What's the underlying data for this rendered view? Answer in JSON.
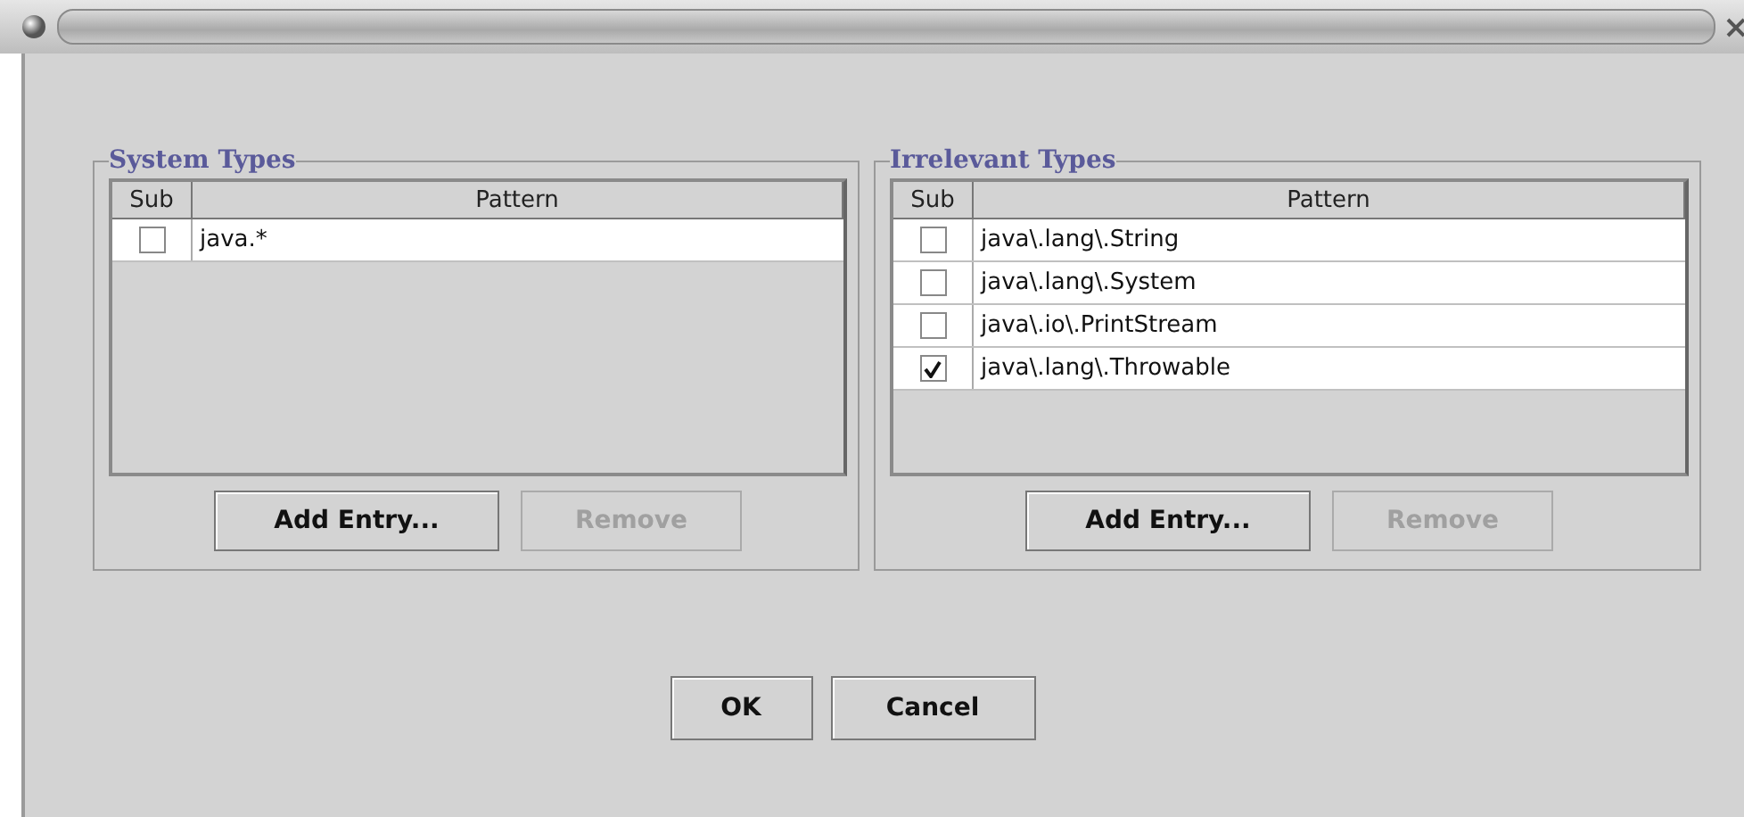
{
  "groups": [
    {
      "title": "System Types",
      "columns": [
        "Sub",
        "Pattern"
      ],
      "rows": [
        {
          "checked": false,
          "pattern": "java.*"
        }
      ],
      "buttons": [
        {
          "label": "Add Entry...",
          "disabled": false
        },
        {
          "label": "Remove",
          "disabled": true
        }
      ]
    },
    {
      "title": "Irrelevant Types",
      "columns": [
        "Sub",
        "Pattern"
      ],
      "rows": [
        {
          "checked": false,
          "pattern": "java\\.lang\\.String"
        },
        {
          "checked": false,
          "pattern": "java\\.lang\\.System"
        },
        {
          "checked": false,
          "pattern": "java\\.io\\.PrintStream"
        },
        {
          "checked": true,
          "pattern": "java\\.lang\\.Throwable"
        }
      ],
      "buttons": [
        {
          "label": "Add Entry...",
          "disabled": false
        },
        {
          "label": "Remove",
          "disabled": true
        }
      ]
    }
  ],
  "buttons": [
    {
      "label": "OK",
      "disabled": false
    },
    {
      "label": "Cancel",
      "disabled": false
    }
  ]
}
